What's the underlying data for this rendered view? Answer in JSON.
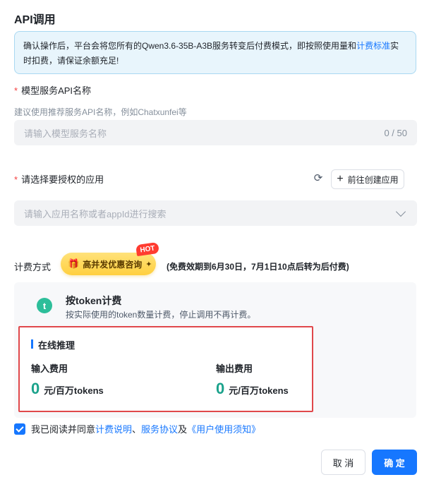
{
  "dialog": {
    "title": "API调用"
  },
  "notice": {
    "text_before": "确认操作后，平台会将您所有的Qwen3.6-35B-A3B服务转变后付费模式，即按照使用量和",
    "link": "计费标准",
    "text_after": "实时扣费，请保证余额充足!"
  },
  "service_name": {
    "required_mark": "*",
    "label": "模型服务API名称",
    "hint": "建议使用推荐服务API名称，例如Chatxunfei等",
    "placeholder": "请输入模型服务名称",
    "counter": "0 / 50"
  },
  "app_select": {
    "required_mark": "*",
    "label": "请选择要授权的应用",
    "refresh_icon": "refresh-icon",
    "create_button": "前往创建应用",
    "placeholder": "请输入应用名称或者appId进行搜索"
  },
  "billing": {
    "label": "计费方式",
    "promo_button": "高并发优惠咨询",
    "hot_badge": "HOT",
    "free_note": "(免费效期到6月30日，7月1日10点后转为后付费)",
    "plan": {
      "title": "按token计费",
      "description": "按实际使用的token数量计费，停止调用不再计费。"
    },
    "inference": {
      "title": "在线推理",
      "input_label": "输入费用",
      "input_value": "0",
      "input_unit": "元/百万tokens",
      "output_label": "输出费用",
      "output_value": "0",
      "output_unit": "元/百万tokens"
    }
  },
  "agreement": {
    "checked": true,
    "text": "我已阅读并同意",
    "link1": "计费说明",
    "sep1": "、",
    "link2": "服务协议",
    "sep2": "及",
    "link3": "《用户使用须知》"
  },
  "footer": {
    "cancel": "取 消",
    "confirm": "确 定"
  },
  "colors": {
    "accent": "#1677ff",
    "required": "#f53f3f",
    "fee_number": "#1aa28b",
    "highlight_border": "#e0484b"
  }
}
